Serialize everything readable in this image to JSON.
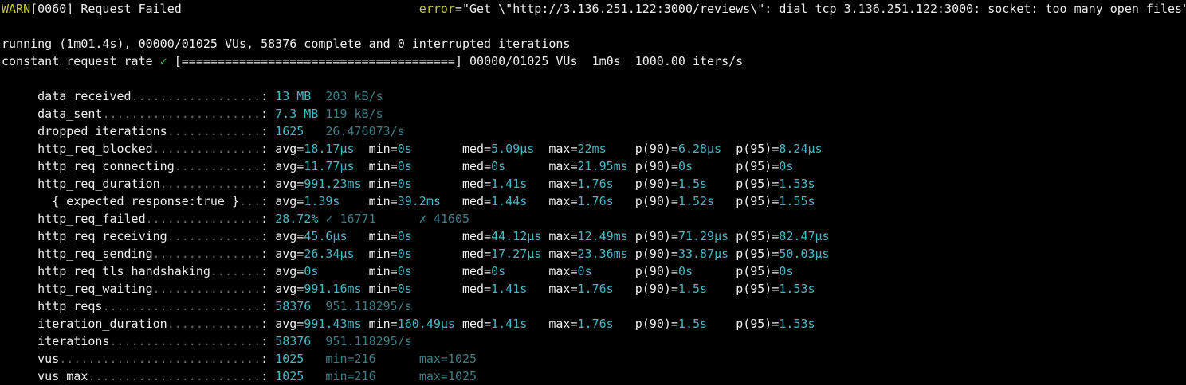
{
  "warn": {
    "prefix": "WARN",
    "code": "[0060]",
    "message": " Request Failed",
    "error_key": "error",
    "error_value": "=\"Get \\\"http://3.136.251.122:3000/reviews\\\": dial tcp 3.136.251.122:3000: socket: too many open files\""
  },
  "status": {
    "running": "running (1m01.4s), 00000/01025 VUs, 58376 complete and 0 interrupted iterations",
    "scenario": "constant_request_rate",
    "check": "✓",
    "bar": "[======================================] 00000/01025 VUs  1m0s  1000.00 iters/s"
  },
  "metrics": [
    {
      "name": "data_received",
      "dots": "..................",
      "value": "13 MB",
      "rate": "203 kB/s"
    },
    {
      "name": "data_sent",
      "dots": "......................",
      "value": "7.3 MB",
      "rate": "119 kB/s"
    },
    {
      "name": "dropped_iterations",
      "dots": ".............",
      "value": "1625",
      "rate": "26.476073/s"
    },
    {
      "name": "http_req_blocked",
      "dots": "...............",
      "stats": [
        "avg=",
        "18.17µs",
        "min=",
        "0s",
        "med=",
        "5.09µs",
        "max=",
        "22ms",
        "p(90)=",
        "6.28µs",
        "p(95)=",
        "8.24µs"
      ]
    },
    {
      "name": "http_req_connecting",
      "dots": "............",
      "stats": [
        "avg=",
        "11.77µs",
        "min=",
        "0s",
        "med=",
        "0s",
        "max=",
        "21.95ms",
        "p(90)=",
        "0s",
        "p(95)=",
        "0s"
      ]
    },
    {
      "name": "http_req_duration",
      "dots": "..............",
      "stats": [
        "avg=",
        "991.23ms",
        "min=",
        "0s",
        "med=",
        "1.41s",
        "max=",
        "1.76s",
        "p(90)=",
        "1.5s",
        "p(95)=",
        "1.53s"
      ]
    },
    {
      "name": "  { expected_response:true }",
      "dots": "...",
      "stats": [
        "avg=",
        "1.39s",
        "min=",
        "39.2ms",
        "med=",
        "1.44s",
        "max=",
        "1.76s",
        "p(90)=",
        "1.52s",
        "p(95)=",
        "1.55s"
      ]
    },
    {
      "name": "http_req_failed",
      "dots": "................",
      "value": "28.72%",
      "pass": "✓ 16771",
      "fail": "✗ 41605"
    },
    {
      "name": "http_req_receiving",
      "dots": ".............",
      "stats": [
        "avg=",
        "45.6µs",
        "min=",
        "0s",
        "med=",
        "44.12µs",
        "max=",
        "12.49ms",
        "p(90)=",
        "71.29µs",
        "p(95)=",
        "82.47µs"
      ]
    },
    {
      "name": "http_req_sending",
      "dots": "...............",
      "stats": [
        "avg=",
        "26.34µs",
        "min=",
        "0s",
        "med=",
        "17.27µs",
        "max=",
        "23.36ms",
        "p(90)=",
        "33.87µs",
        "p(95)=",
        "50.03µs"
      ]
    },
    {
      "name": "http_req_tls_handshaking",
      "dots": ".......",
      "stats": [
        "avg=",
        "0s",
        "min=",
        "0s",
        "med=",
        "0s",
        "max=",
        "0s",
        "p(90)=",
        "0s",
        "p(95)=",
        "0s"
      ]
    },
    {
      "name": "http_req_waiting",
      "dots": "...............",
      "stats": [
        "avg=",
        "991.16ms",
        "min=",
        "0s",
        "med=",
        "1.41s",
        "max=",
        "1.76s",
        "p(90)=",
        "1.5s",
        "p(95)=",
        "1.53s"
      ]
    },
    {
      "name": "http_reqs",
      "dots": "......................",
      "value": "58376",
      "rate": "951.118295/s"
    },
    {
      "name": "iteration_duration",
      "dots": ".............",
      "stats": [
        "avg=",
        "991.43ms",
        "min=",
        "160.49µs",
        "med=",
        "1.41s",
        "max=",
        "1.76s",
        "p(90)=",
        "1.5s",
        "p(95)=",
        "1.53s"
      ]
    },
    {
      "name": "iterations",
      "dots": ".....................",
      "value": "58376",
      "rate": "951.118295/s"
    },
    {
      "name": "vus",
      "dots": "............................",
      "value": "1025",
      "min": "min=216",
      "max": "max=1025"
    },
    {
      "name": "vus_max",
      "dots": "........................",
      "value": "1025",
      "min": "min=216",
      "max": "max=1025"
    }
  ],
  "colors": {
    "background": "#000000",
    "text": "#eeeeee",
    "warn": "#c9c937",
    "value": "#45b8c6",
    "dim_value": "#3c7d86",
    "check": "#3fb950"
  }
}
